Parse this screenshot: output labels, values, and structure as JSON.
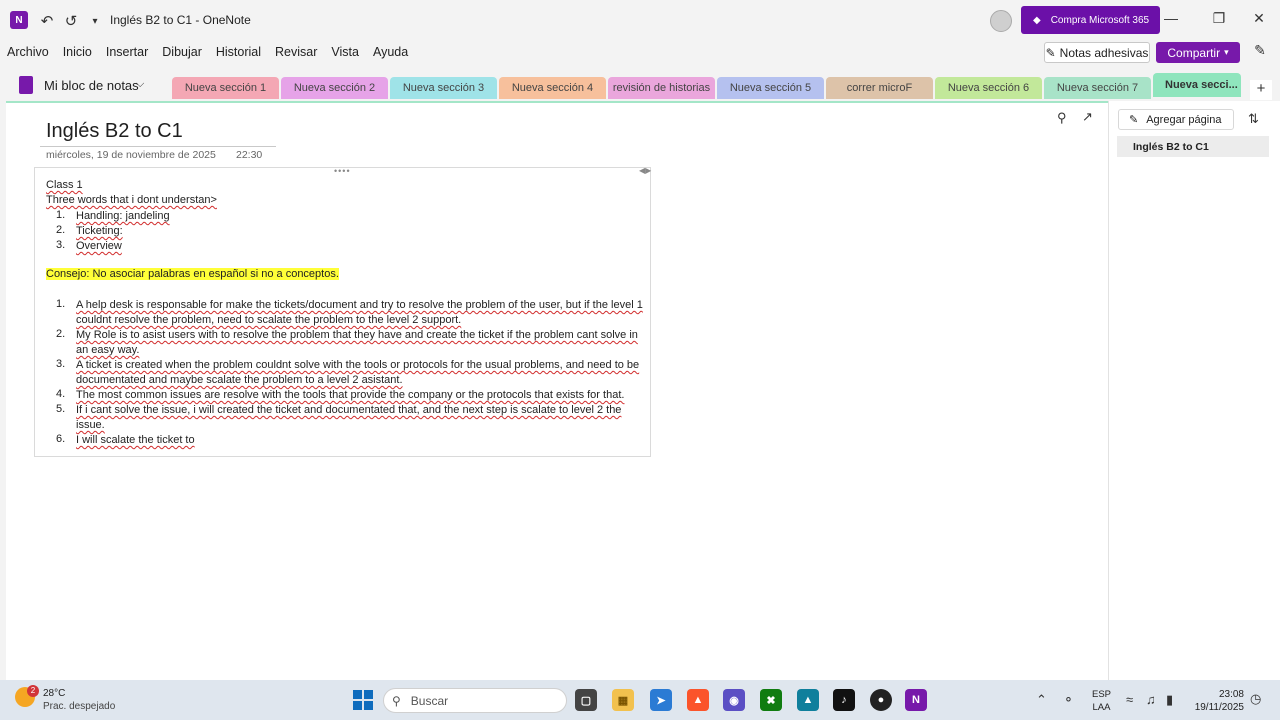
{
  "window": {
    "title": "Inglés B2 to C1",
    "app": "OneNote",
    "separator": "-",
    "m365_label": "Compra Microsoft 365"
  },
  "menu": [
    "Archivo",
    "Inicio",
    "Insertar",
    "Dibujar",
    "Historial",
    "Revisar",
    "Vista",
    "Ayuda"
  ],
  "toolbar": {
    "sticky_label": "Notas adhesivas",
    "share_label": "Compartir"
  },
  "notebook": {
    "name": "Mi bloc de notas"
  },
  "sections": [
    {
      "label": "Nueva sección 1",
      "color": "#f4a7b4"
    },
    {
      "label": "Nueva sección 2",
      "color": "#e6a3e8"
    },
    {
      "label": "Nueva sección 3",
      "color": "#9fe3e8"
    },
    {
      "label": "Nueva sección 4",
      "color": "#f7c09c"
    },
    {
      "label": "revisión de historias",
      "color": "#eaa6dc"
    },
    {
      "label": "Nueva sección 5",
      "color": "#b5c1ef"
    },
    {
      "label": "correr microF",
      "color": "#ddc3a9"
    },
    {
      "label": "Nueva sección 6",
      "color": "#c2e89a"
    },
    {
      "label": "Nueva sección 7",
      "color": "#a8e3c8"
    },
    {
      "label": "Nueva secci...",
      "color": "#8fe5bd"
    }
  ],
  "page": {
    "title": "Inglés B2 to C1",
    "date": "miércoles, 19 de noviembre de 2025",
    "time": "22:30"
  },
  "note": {
    "line1": "Class 1",
    "line2": "Three words that i dont understan>",
    "words": [
      {
        "n": "1.",
        "text": "Handling: jandeling"
      },
      {
        "n": "2.",
        "text": "Ticketing:"
      },
      {
        "n": "3.",
        "text": "Overview"
      }
    ],
    "tip": "Consejo: No asociar palabras en español si no a conceptos.",
    "answers": [
      {
        "n": "1.",
        "text": "A help desk is responsable for make the tickets/document and try to resolve the problem of the user, but if the level 1 couldnt resolve the problem, need to scalate the problem to the level 2 support."
      },
      {
        "n": "2.",
        "text": "My Role is to asist users with to resolve the problem that they have and create the ticket if the problem cant solve in an easy way."
      },
      {
        "n": "3.",
        "text": "A ticket is created when the problem couldnt solve with the tools or protocols for the usual problems, and need to be documentated and maybe scalate the problem to a level 2 asistant."
      },
      {
        "n": "4.",
        "text": "The most common issues are resolve with the tools that provide the company or the protocols that exists for that."
      },
      {
        "n": "5.",
        "text": "If i cant solve the issue, i will created the ticket and documentated that, and the next step is scalate to level 2 the issue."
      },
      {
        "n": "6.",
        "text": "I will scalate the ticket to"
      }
    ]
  },
  "pane": {
    "add_page_label": "Agregar página",
    "pages": [
      "Inglés B2 to C1"
    ]
  },
  "taskbar": {
    "weather_temp": "28°C",
    "weather_desc": "Prac. despejado",
    "weather_badge": "2",
    "search_placeholder": "Buscar",
    "lang_1": "ESP",
    "lang_2": "LAA",
    "time": "23:08",
    "date": "19/11/2025"
  },
  "icons": [
    "back-icon",
    "undo-icon",
    "customize-icon",
    "search-icon",
    "expand-icon",
    "sort-icon",
    "edit-icon",
    "microphone-icon",
    "wifi-icon",
    "volume-icon",
    "battery-icon",
    "notification-icon"
  ]
}
